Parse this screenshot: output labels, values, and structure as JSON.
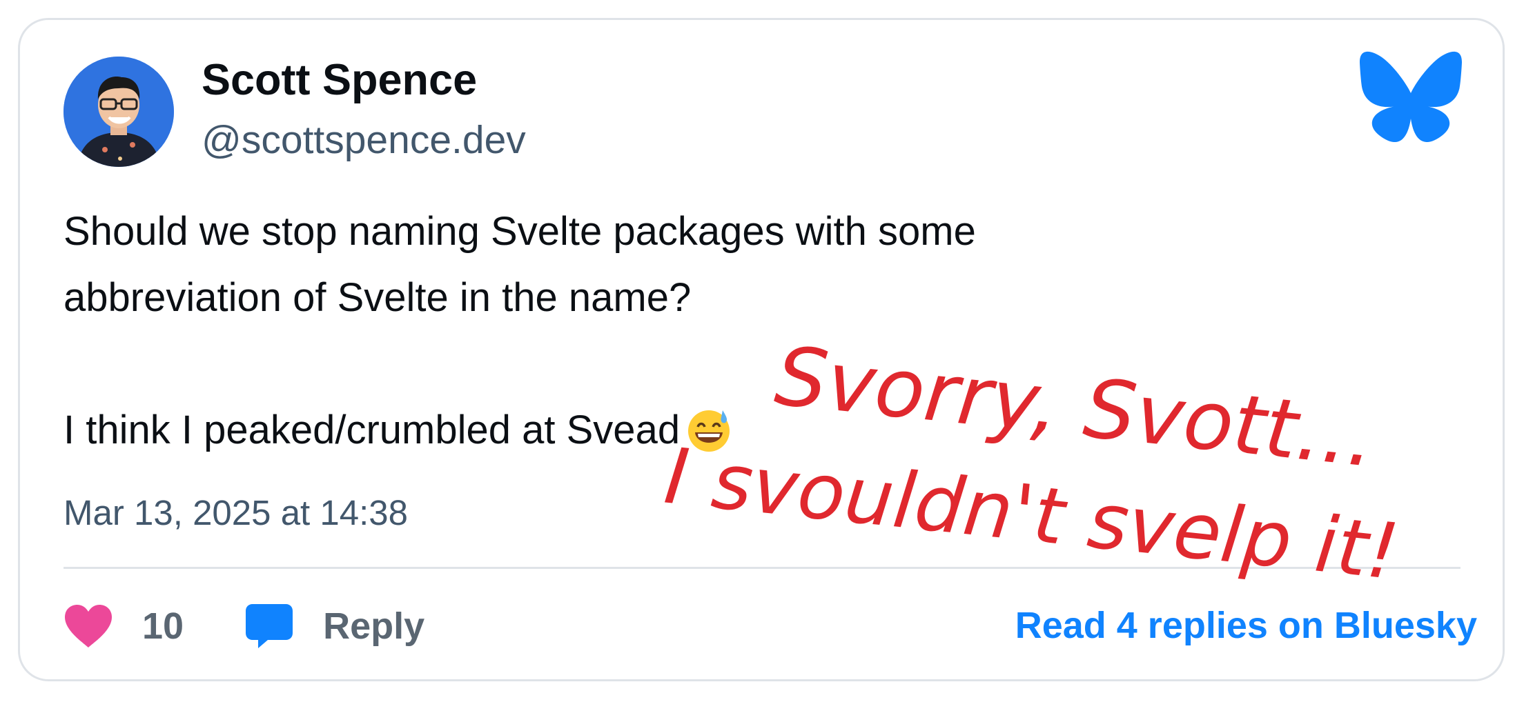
{
  "post": {
    "author": {
      "display_name": "Scott Spence",
      "handle": "@scottspence.dev",
      "avatar": "profile-photo"
    },
    "text_lines": [
      "Should we stop naming Svelte packages with some",
      "abbreviation of Svelte in the name?",
      "I think I peaked/crumbled at Svead"
    ],
    "emoji": "grinning-face-with-sweat",
    "timestamp": "Mar 13, 2025 at 14:38",
    "likes": {
      "icon": "heart-icon",
      "count": "10"
    },
    "reply": {
      "icon": "speech-bubble-icon",
      "label": "Reply"
    },
    "read_replies_link": "Read 4 replies on Bluesky",
    "platform_logo": "bluesky-butterfly-icon"
  },
  "annotation": {
    "line1": "Svorry, Svott...",
    "line2": "I svouldn't svelp it!",
    "color": "#e0282e"
  },
  "colors": {
    "bluesky_blue": "#1083fe",
    "heart_pink": "#ec4899",
    "muted_text": "#42576c",
    "border": "#dfe3e8"
  }
}
